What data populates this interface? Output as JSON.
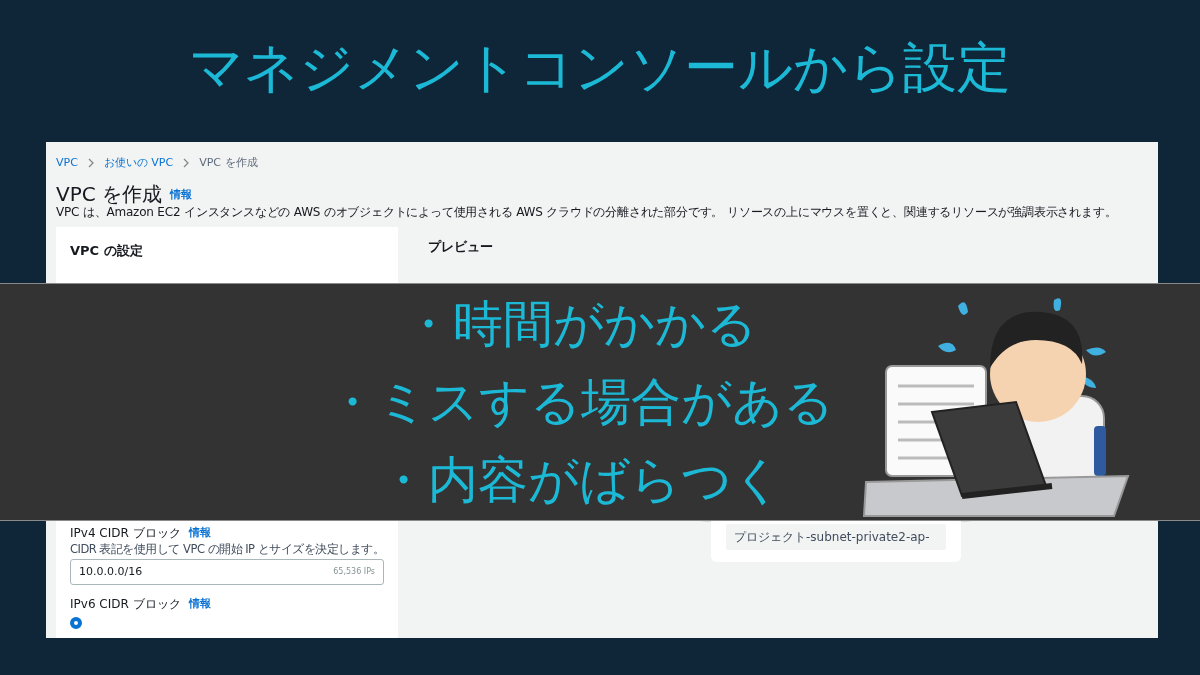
{
  "slide_title": "マネジメントコンソールから設定",
  "console": {
    "breadcrumbs": [
      {
        "label": "VPC",
        "link": true
      },
      {
        "label": "お使いの VPC",
        "link": true
      },
      {
        "label": "VPC を作成",
        "link": false
      }
    ],
    "heading": "VPC を作成",
    "heading_info": "情報",
    "description": "VPC は、Amazon EC2 インスタンスなどの AWS のオブジェクトによって使用される AWS クラウドの分離された部分です。 リソースの上にマウスを置くと、関連するリソースが強調表示されます。",
    "settings": {
      "title": "VPC の設定",
      "ipv4": {
        "label": "IPv4 CIDR ブロック",
        "info": "情報",
        "hint": "CIDR 表記を使用して VPC の開始 IP とサイズを決定します。",
        "value": "10.0.0.0/16",
        "suffix": "65,536 IPs"
      },
      "ipv6": {
        "label": "IPv6 CIDR ブロック",
        "info": "情報",
        "option_selected": true
      }
    },
    "preview": {
      "title": "プレビュー",
      "subnet": "プロジェクト-subnet-private2-ap-"
    }
  },
  "overlay": {
    "points": [
      "・時間がかかる",
      "・ミスする場合がある",
      "・内容がばらつく"
    ]
  }
}
